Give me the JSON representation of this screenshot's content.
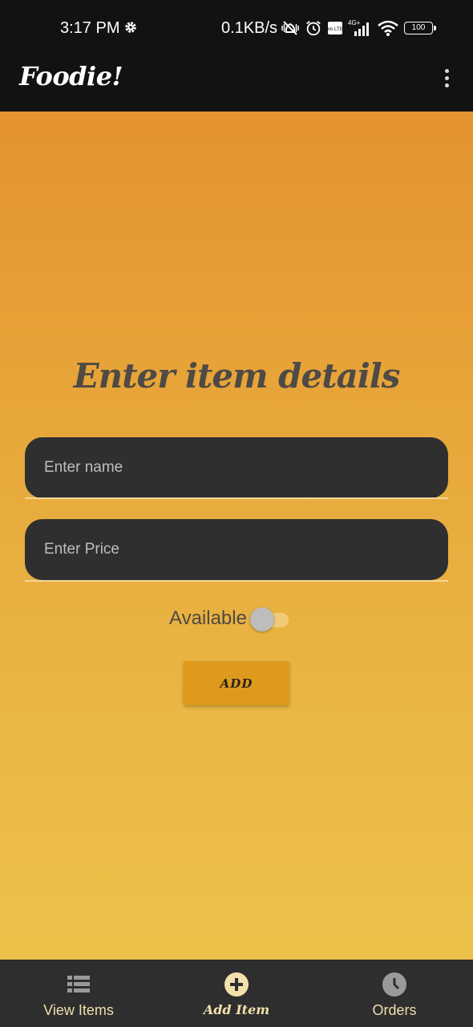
{
  "status_bar": {
    "time": "3:17 PM",
    "network_speed": "0.1KB/s",
    "network_type": "4G+",
    "volte": "Vo LTE",
    "battery": "100"
  },
  "app_bar": {
    "title": "Foodie!"
  },
  "form": {
    "heading": "Enter item details",
    "name_placeholder": "Enter name",
    "name_value": "",
    "price_placeholder": "Enter Price",
    "price_value": "",
    "available_label": "Available",
    "available_on": false,
    "add_label": "ADD"
  },
  "bottom_nav": {
    "items": [
      {
        "label": "View Items",
        "icon": "list-icon",
        "active": false
      },
      {
        "label": "Add Item",
        "icon": "add-circle-icon",
        "active": true
      },
      {
        "label": "Orders",
        "icon": "clock-icon",
        "active": false
      }
    ]
  },
  "colors": {
    "app_bar": "#121212",
    "gradient_top": "#e3932f",
    "gradient_bottom": "#ecc24b",
    "field_bg": "#2f2f2f",
    "button": "#de9a1d",
    "nav_bg": "#2e2e2e",
    "nav_text": "#f0deab"
  }
}
